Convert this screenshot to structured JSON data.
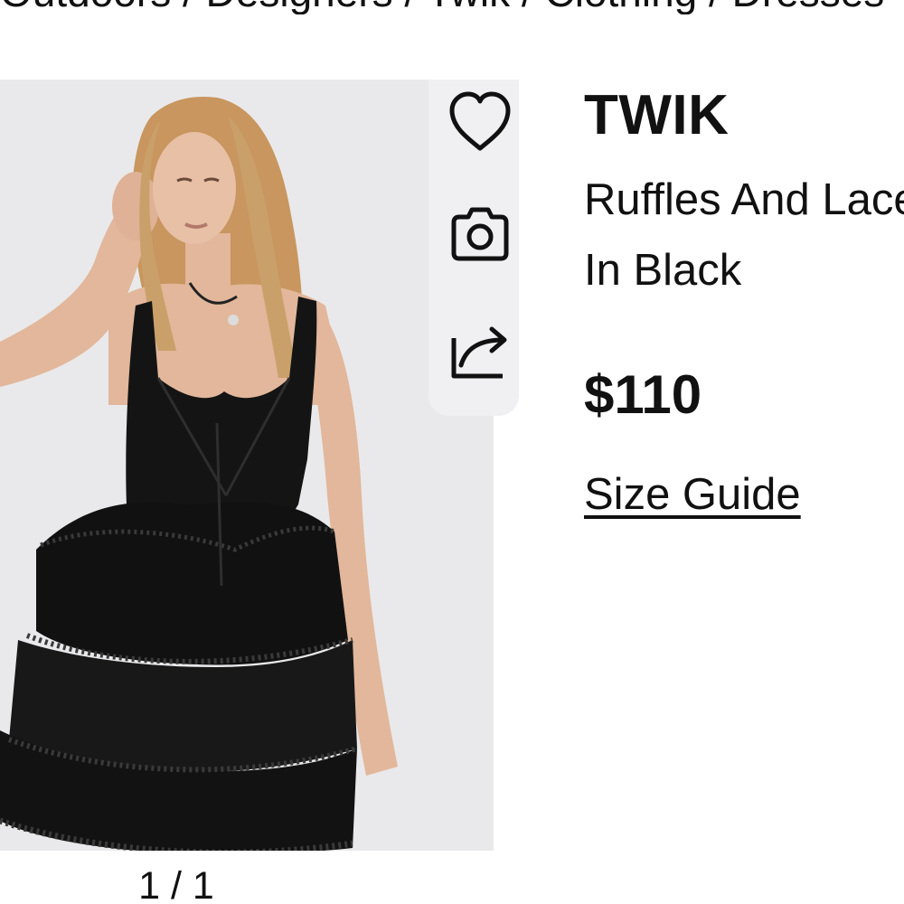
{
  "breadcrumb": {
    "text": "Outdoors / Designers / Twik / Clothing / Dresses"
  },
  "gallery": {
    "pager": "1 / 1",
    "image_alt": "Model wearing black ruffle and lace mini dress"
  },
  "actions": {
    "wishlist_icon": "heart-icon",
    "photo_search_icon": "camera-icon",
    "share_icon": "share-icon"
  },
  "product": {
    "brand": "TWIK",
    "name_line1": "Ruffles And Lace Dress",
    "name_line2": "In Black",
    "price": "$110",
    "size_guide": "Size Guide"
  },
  "colors": {
    "text": "#111111",
    "image_bg": "#e9e9eb",
    "rail_bg": "#f0f0f2",
    "dress": "#141414",
    "skin": "#e2b79b",
    "hair": "#c8965e"
  }
}
